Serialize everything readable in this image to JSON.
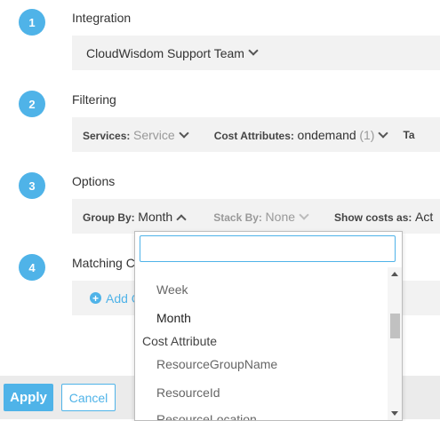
{
  "steps": [
    {
      "number": "1",
      "title": "Integration"
    },
    {
      "number": "2",
      "title": "Filtering"
    },
    {
      "number": "3",
      "title": "Options"
    },
    {
      "number": "4",
      "title": "Matching C"
    }
  ],
  "integration": {
    "value": "CloudWisdom Support Team"
  },
  "filtering": {
    "services_label": "Services:",
    "services_value": "Service",
    "cost_label": "Cost Attributes:",
    "cost_value": "ondemand",
    "cost_count": "(1)",
    "tags_label": "Ta"
  },
  "options": {
    "group_by_label": "Group By:",
    "group_by_value": "Month",
    "stack_by_label": "Stack By:",
    "stack_by_value": "None",
    "show_costs_label": "Show costs as:",
    "show_costs_value": "Act"
  },
  "matching": {
    "add_label": "Add C"
  },
  "dropdown": {
    "search_placeholder": "",
    "items": [
      {
        "label": "Week"
      },
      {
        "label": "Month",
        "selected": true
      }
    ],
    "group_label": "Cost Attribute",
    "group_items": [
      "ResourceGroupName",
      "ResourceId",
      "ResourceLocation"
    ]
  },
  "footer": {
    "apply_label": "Apply",
    "cancel_label": "Cancel"
  },
  "colors": {
    "accent": "#4fb3e8",
    "panel": "#f2f2f2",
    "footer": "#ebebeb"
  }
}
